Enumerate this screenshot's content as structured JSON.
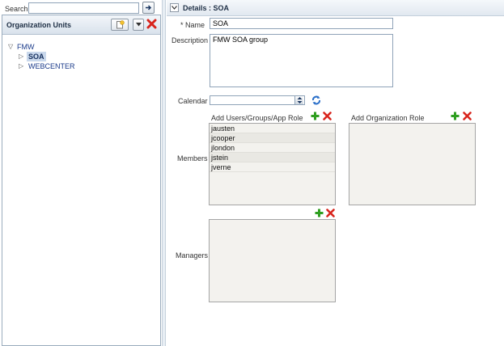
{
  "search": {
    "label": "Search",
    "value": ""
  },
  "org_units": {
    "title": "Organization Units",
    "tree": {
      "root": "FMW",
      "children": [
        {
          "label": "SOA",
          "selected": true
        },
        {
          "label": "WEBCENTER",
          "selected": false
        }
      ]
    }
  },
  "details": {
    "header": "Details : SOA",
    "name_label": "* Name",
    "name_value": "SOA",
    "description_label": "Description",
    "description_value": "FMW SOA group",
    "calendar_label": "Calendar",
    "calendar_value": "",
    "members_label": "Members",
    "managers_label": "Managers",
    "users_header": "Add Users/Groups/App Role",
    "users": [
      "jausten",
      "jcooper",
      "jlondon",
      "jstein",
      "jverne"
    ],
    "roles_header": "Add Organization Role"
  },
  "colors": {
    "add_green": "#2e9e1f",
    "delete_red": "#d8241c",
    "header_text": "#1e2f45",
    "selection": "#c9d8ec"
  },
  "icons": {
    "go": "arrow-right-icon",
    "new": "new-org-unit-icon",
    "menu": "chevron-down-icon",
    "delete": "delete-x-icon",
    "collapse": "collapse-icon",
    "calendar_select": "dropdown-icon",
    "calendar_refresh": "refresh-icon"
  }
}
